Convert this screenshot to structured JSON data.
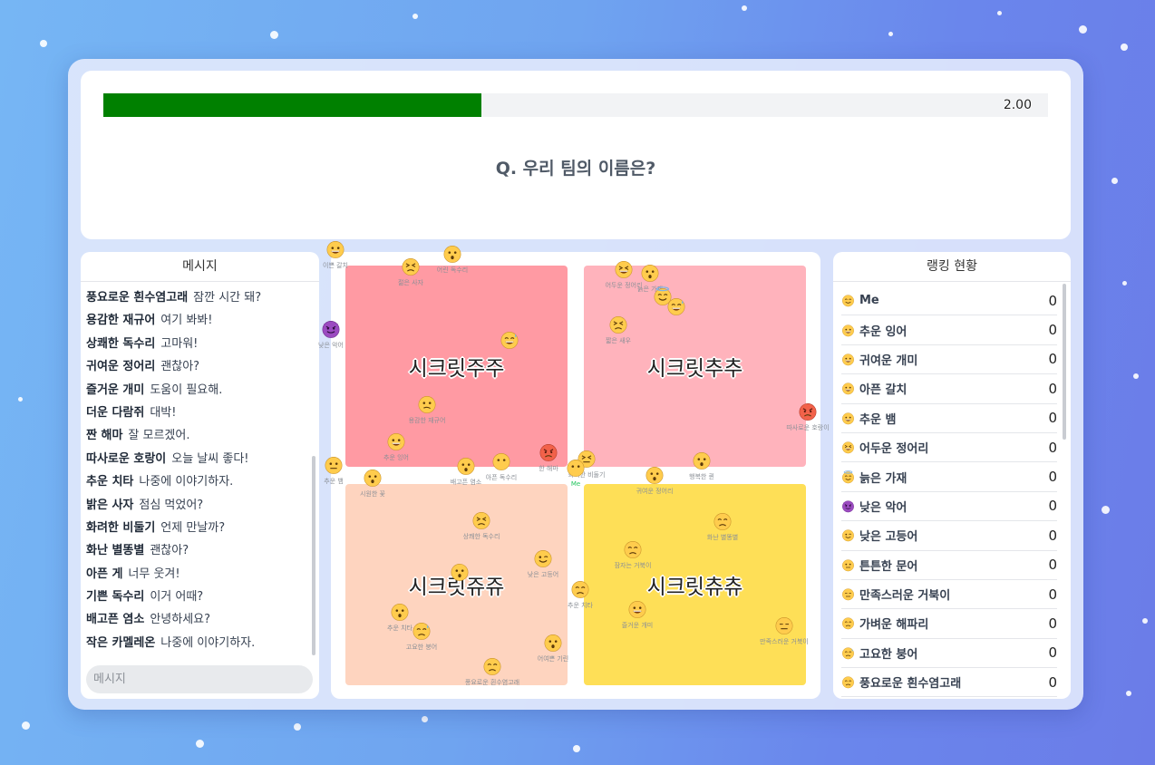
{
  "timer": {
    "value": "2.00",
    "progress_fraction": 0.4
  },
  "question": "Q. 우리 팀의 이름은?",
  "messages": {
    "title": "메시지",
    "input_placeholder": "메시지",
    "items": [
      {
        "sender": "풍요로운 흰수염고래",
        "text": "잠깐 시간 돼?"
      },
      {
        "sender": "용감한 재규어",
        "text": "여기 봐봐!"
      },
      {
        "sender": "상쾌한 독수리",
        "text": "고마워!"
      },
      {
        "sender": "귀여운 정어리",
        "text": "괜찮아?"
      },
      {
        "sender": "즐거운 개미",
        "text": "도움이 필요해."
      },
      {
        "sender": "더운 다람쥐",
        "text": "대박!"
      },
      {
        "sender": "짠 해마",
        "text": "잘 모르겠어."
      },
      {
        "sender": "따사로운 호랑이",
        "text": "오늘 날씨 좋다!"
      },
      {
        "sender": "추운 치타",
        "text": "나중에 이야기하자."
      },
      {
        "sender": "밝은 사자",
        "text": "점심 먹었어?"
      },
      {
        "sender": "화려한 비둘기",
        "text": "언제 만날까?"
      },
      {
        "sender": "화난 별똥별",
        "text": "괜찮아?"
      },
      {
        "sender": "아픈 게",
        "text": "너무 웃겨!"
      },
      {
        "sender": "기쁜 독수리",
        "text": "이거 어때?"
      },
      {
        "sender": "배고픈 염소",
        "text": "안녕하세요?"
      },
      {
        "sender": "작은 카멜레온",
        "text": "나중에 이야기하자."
      }
    ]
  },
  "zones": [
    {
      "label": "시크릿주주",
      "color": "#ff9aa3"
    },
    {
      "label": "시크릿추추",
      "color": "#ffb3bc"
    },
    {
      "label": "시크릿쥬쥬",
      "color": "#fed4bf"
    },
    {
      "label": "시크릿츄츄",
      "color": "#fedf57"
    }
  ],
  "ranking": {
    "title": "랭킹 현황",
    "items": [
      {
        "name": "Me",
        "score": "0",
        "emoji": "smile-closed"
      },
      {
        "name": "추운 잉어",
        "score": "0",
        "emoji": "grin"
      },
      {
        "name": "귀여운 개미",
        "score": "0",
        "emoji": "big-smile"
      },
      {
        "name": "아픈 갈치",
        "score": "0",
        "emoji": "grin"
      },
      {
        "name": "추운 뱀",
        "score": "0",
        "emoji": "grin"
      },
      {
        "name": "어두운 정어리",
        "score": "0",
        "emoji": "laugh"
      },
      {
        "name": "늙은 가재",
        "score": "0",
        "emoji": "halo"
      },
      {
        "name": "낮은 악어",
        "score": "0",
        "emoji": "devil"
      },
      {
        "name": "낮은 고등어",
        "score": "0",
        "emoji": "wink"
      },
      {
        "name": "튼튼한 문어",
        "score": "0",
        "emoji": "neutral"
      },
      {
        "name": "만족스러운 거북이",
        "score": "0",
        "emoji": "expressionless"
      },
      {
        "name": "가벼운 해파리",
        "score": "0",
        "emoji": "disappointed"
      },
      {
        "name": "고요한 붕어",
        "score": "0",
        "emoji": "sweat"
      },
      {
        "name": "풍요로운 흰수염고래",
        "score": "0",
        "emoji": "pensive"
      }
    ]
  },
  "players": [
    {
      "name": "이쁜 갈치",
      "emoji": "grin"
    },
    {
      "name": "젊은 사자",
      "emoji": "weary"
    },
    {
      "name": "어린 독수리",
      "emoji": "surprised"
    },
    {
      "name": "낮은 악어",
      "emoji": "devil"
    },
    {
      "name": "",
      "emoji": "sweat-smile"
    },
    {
      "name": "추운 뱀",
      "emoji": "neutral"
    },
    {
      "name": "용감한 재규어",
      "emoji": "confused"
    },
    {
      "name": "추운 잉어",
      "emoji": "grin"
    },
    {
      "name": "시원한 꽃",
      "emoji": "hushed"
    },
    {
      "name": "배고픈 염소",
      "emoji": "fearful"
    },
    {
      "name": "아픈 독수리",
      "emoji": "blank"
    },
    {
      "name": "한 해마",
      "emoji": "angry"
    },
    {
      "name": "어두운 정어리",
      "emoji": "laugh"
    },
    {
      "name": "늙은 가재",
      "emoji": "fearful"
    },
    {
      "name": "",
      "emoji": "halo"
    },
    {
      "name": "",
      "emoji": "sweat-smile"
    },
    {
      "name": "짧은 새우",
      "emoji": "confounded"
    },
    {
      "name": "따사로운 호랑이",
      "emoji": "angry"
    },
    {
      "name": "화려한 비둘기",
      "emoji": "triumph"
    },
    {
      "name": "Me",
      "emoji": "blank",
      "is_me": true
    },
    {
      "name": "귀여운 정어리",
      "emoji": "kissing"
    },
    {
      "name": "행복한 퀸",
      "emoji": "scream"
    },
    {
      "name": "상쾌한 독수리",
      "emoji": "confounded"
    },
    {
      "name": "낮은 고등어",
      "emoji": "wink"
    },
    {
      "name": "",
      "emoji": "dizzy"
    },
    {
      "name": "추운 치타",
      "emoji": "kissing"
    },
    {
      "name": "고요한 붕어",
      "emoji": "sweat"
    },
    {
      "name": "풍요로운 흰수염고래",
      "emoji": "pensive"
    },
    {
      "name": "어여쁜 기린",
      "emoji": "flushed"
    },
    {
      "name": "추운 치타",
      "emoji": "sad"
    },
    {
      "name": "화난 별똥별",
      "emoji": "sad"
    },
    {
      "name": "잠자는 거북이",
      "emoji": "sleeping"
    },
    {
      "name": "즐거운 개미",
      "emoji": "big-smile"
    },
    {
      "name": "만족스러운 거북이",
      "emoji": "expressionless"
    }
  ]
}
